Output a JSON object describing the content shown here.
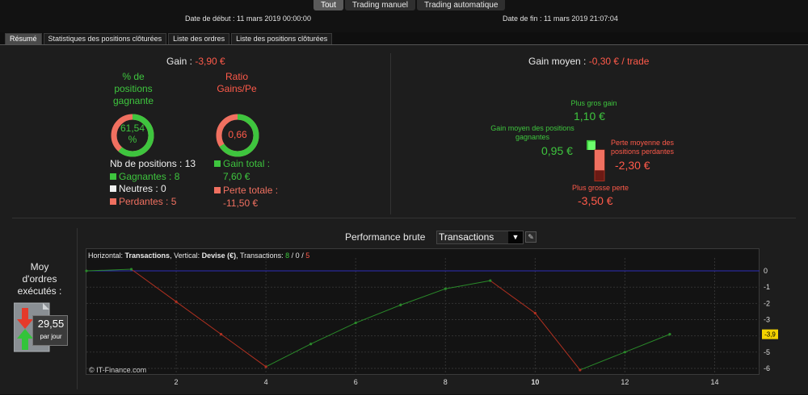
{
  "mode_tabs": [
    "Tout",
    "Trading manuel",
    "Trading automatique"
  ],
  "dates": {
    "start": "Date de début : 11 mars 2019 00:00:00",
    "end": "Date de fin : 11 mars 2019 21:07:04"
  },
  "tabs": [
    "Résumé",
    "Statistiques des positions clôturées",
    "Liste des ordres",
    "Liste des positions clôturées"
  ],
  "summary": {
    "gain_label": "Gain : ",
    "gain_value": "-3,90 €",
    "pct_label_1": "% de",
    "pct_label_2": "positions",
    "pct_label_3": "gagnante",
    "pct_value_1": "61,54",
    "pct_value_2": "%",
    "pct_fraction": 0.6154,
    "ratio_label_1": "Ratio",
    "ratio_label_2": "Gains/Pe",
    "ratio_value": "0,66",
    "ratio_fraction": 0.66,
    "nb_positions": "Nb de positions : 13",
    "gagnantes": "Gagnantes : 8",
    "neutres": "Neutres : 0",
    "perdantes": "Perdantes : 5",
    "gain_total_label": "Gain total :",
    "gain_total_value": "7,60 €",
    "perte_totale_label": "Perte totale :",
    "perte_totale_value": "-11,50 €"
  },
  "gain_moyen": {
    "label": "Gain moyen : ",
    "value": "-0,30 € / trade",
    "plus_gros_gain_label": "Plus gros gain",
    "plus_gros_gain_value": "1,10 €",
    "gain_moyen_pos_label_1": "Gain moyen des positions",
    "gain_moyen_pos_label_2": "gagnantes",
    "gain_moyen_pos_value": "0,95 €",
    "perte_moy_label_1": "Perte moyenne des",
    "perte_moy_label_2": "positions perdantes",
    "perte_moy_value": "-2,30 €",
    "plus_grosse_perte_label": "Plus grosse perte",
    "plus_grosse_perte_value": "-3,50 €"
  },
  "moy_ordres": {
    "label_1": "Moy",
    "label_2": "d'ordres",
    "label_3": "exécutés :",
    "value": "29,55",
    "unit": "par jour"
  },
  "performance": {
    "title": "Performance brute",
    "select_value": "Transactions",
    "legend": {
      "h_label": "Horizontal: ",
      "h_value": "Transactions",
      "v_label": ", Vertical: ",
      "v_value": "Devise (€)",
      "t_label": ", Transactions: ",
      "t_win": "8",
      "t_sep1": " / ",
      "t_neutral": "0",
      "t_sep2": " / ",
      "t_loss": "5"
    },
    "copyright": "© IT-Finance.com",
    "last_value_tag": "-3,9"
  },
  "colors": {
    "green": "#3ec53e",
    "red": "#ff5a4a",
    "salmon": "#f07060",
    "dark_red": "#6b1a14"
  },
  "chart_data": {
    "type": "line",
    "x": [
      0,
      1,
      2,
      3,
      4,
      5,
      6,
      7,
      8,
      9,
      10,
      11,
      12,
      13
    ],
    "y": [
      0,
      0.1,
      -1.9,
      -3.9,
      -5.9,
      -4.5,
      -3.2,
      -2.1,
      -1.1,
      -0.6,
      -2.6,
      -6.1,
      -5,
      -3.9
    ],
    "segment_colors": [
      "green",
      "red",
      "red",
      "red",
      "green",
      "green",
      "green",
      "green",
      "green",
      "red",
      "red",
      "green",
      "green"
    ],
    "xlim": [
      0,
      15
    ],
    "ylim": [
      -6.3,
      0.3
    ],
    "x_ticks": [
      2,
      4,
      6,
      8,
      10,
      12,
      14
    ],
    "y_ticks": [
      0,
      -1,
      -2,
      -3,
      -4,
      -5,
      -6
    ],
    "reference_line": 0
  }
}
